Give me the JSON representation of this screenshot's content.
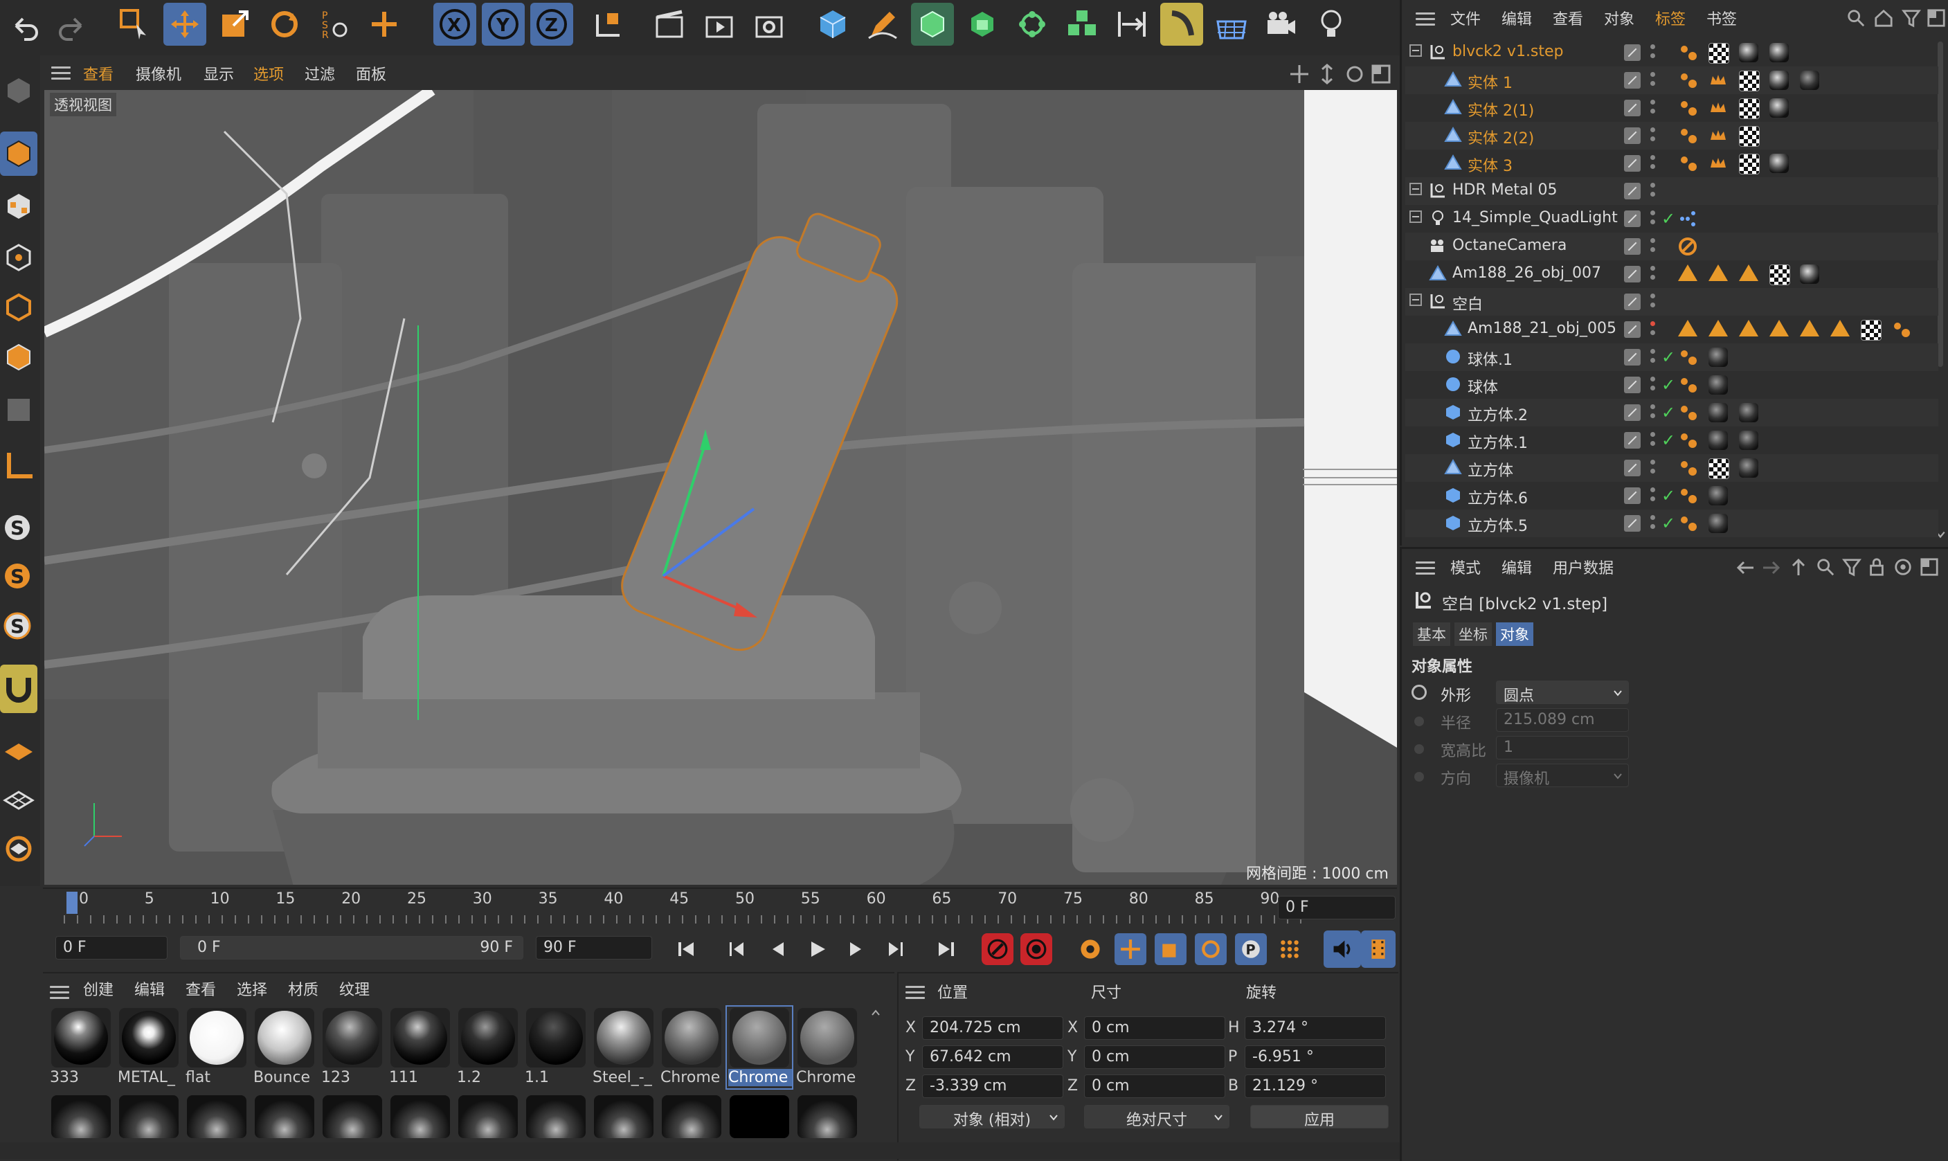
{
  "viewport_menu": [
    "查看",
    "摄像机",
    "显示",
    "选项",
    "过滤",
    "面板"
  ],
  "viewport_label": "透视视图",
  "grid_distance": "网格间距 : 1000 cm",
  "object_manager": {
    "menu": [
      "文件",
      "编辑",
      "查看",
      "对象",
      "标签",
      "书签"
    ],
    "rows": [
      {
        "name": "blvck2 v1.step",
        "orange": true,
        "indent": 0
      },
      {
        "name": "实体 1",
        "orange": true,
        "indent": 1
      },
      {
        "name": "实体 2(1)",
        "orange": true,
        "indent": 1
      },
      {
        "name": "实体 2(2)",
        "orange": true,
        "indent": 1
      },
      {
        "name": "实体 3",
        "orange": true,
        "indent": 1
      },
      {
        "name": "HDR Metal 05",
        "orange": false,
        "indent": 0
      },
      {
        "name": "14_Simple_QuadLight",
        "orange": false,
        "indent": 0
      },
      {
        "name": "OctaneCamera",
        "orange": false,
        "indent": 0
      },
      {
        "name": "Am188_26_obj_007",
        "orange": false,
        "indent": 0
      },
      {
        "name": "空白",
        "orange": false,
        "indent": 0
      },
      {
        "name": "Am188_21_obj_005",
        "orange": false,
        "indent": 1
      },
      {
        "name": "球体.1",
        "orange": false,
        "indent": 1
      },
      {
        "name": "球体",
        "orange": false,
        "indent": 1
      },
      {
        "name": "立方体.2",
        "orange": false,
        "indent": 1
      },
      {
        "name": "立方体.1",
        "orange": false,
        "indent": 1
      },
      {
        "name": "立方体",
        "orange": false,
        "indent": 1
      },
      {
        "name": "立方体.6",
        "orange": false,
        "indent": 1
      },
      {
        "name": "立方体.5",
        "orange": false,
        "indent": 1
      }
    ]
  },
  "attributes": {
    "menu": [
      "模式",
      "编辑",
      "用户数据"
    ],
    "title": "空白 [blvck2 v1.step]",
    "tabs": [
      "基本",
      "坐标",
      "对象"
    ],
    "section": "对象属性",
    "fields": [
      {
        "label": "外形",
        "value": "圆点"
      },
      {
        "label": "半径",
        "value": "215.089 cm"
      },
      {
        "label": "宽高比",
        "value": "1"
      },
      {
        "label": "方向",
        "value": "摄像机"
      }
    ]
  },
  "timeline": {
    "ticks": [
      "0",
      "5",
      "10",
      "15",
      "20",
      "25",
      "30",
      "35",
      "40",
      "45",
      "50",
      "55",
      "60",
      "65",
      "70",
      "75",
      "80",
      "85",
      "90"
    ],
    "current_frame": "0 F",
    "start_frame": "0 F",
    "range_start": "0 F",
    "range_end": "90 F",
    "end_frame": "90 F"
  },
  "material_manager": {
    "menu": [
      "创建",
      "编辑",
      "查看",
      "选择",
      "材质",
      "纹理"
    ],
    "materials": [
      "333",
      "METAL_",
      "flat",
      "Bounce",
      "123",
      "111",
      "1.2",
      "1.1",
      "Steel_-_",
      "Chrome",
      "Chrome",
      "Chrome"
    ],
    "selected_index": 10
  },
  "coordinates": {
    "headers": [
      "位置",
      "尺寸",
      "旋转"
    ],
    "position": [
      {
        "axis": "X",
        "value": "204.725 cm"
      },
      {
        "axis": "Y",
        "value": "67.642 cm"
      },
      {
        "axis": "Z",
        "value": "-3.339 cm"
      }
    ],
    "size": [
      {
        "axis": "X",
        "value": "0 cm"
      },
      {
        "axis": "Y",
        "value": "0 cm"
      },
      {
        "axis": "Z",
        "value": "0 cm"
      }
    ],
    "rotation": [
      {
        "axis": "H",
        "value": "3.274 °"
      },
      {
        "axis": "P",
        "value": "-6.951 °"
      },
      {
        "axis": "B",
        "value": "21.129 °"
      }
    ],
    "mode_select": "对象 (相对)",
    "size_select": "绝对尺寸",
    "apply_label": "应用"
  },
  "toolbar_axes": [
    "X",
    "Y",
    "Z"
  ],
  "colors": {
    "accent": "#4a6ea8",
    "orange": "#e39a2e",
    "panel": "#2e2e2e",
    "viewport": "#5c5c5c"
  }
}
